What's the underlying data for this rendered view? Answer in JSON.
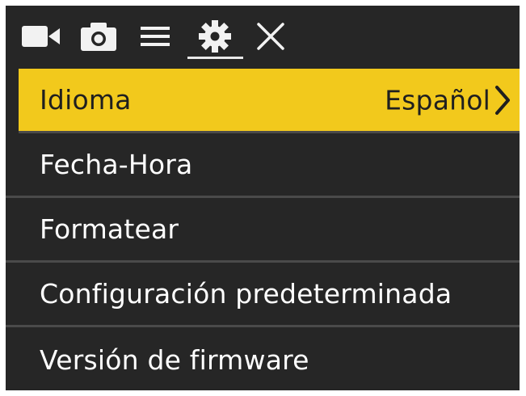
{
  "toolbar": {
    "icons": [
      "video-camera-icon",
      "photo-camera-icon",
      "menu-lines-icon",
      "gear-icon",
      "close-icon"
    ],
    "active_tab": "gear-icon"
  },
  "menu": {
    "items": [
      {
        "label": "Idioma",
        "value": "Español",
        "selected": true
      },
      {
        "label": "Fecha-Hora"
      },
      {
        "label": "Formatear"
      },
      {
        "label": "Configuración predeterminada"
      },
      {
        "label": "Versión de firmware"
      }
    ]
  },
  "colors": {
    "background": "#262626",
    "highlight": "#f2c91c",
    "text": "#ffffff",
    "selected_text": "#1f1f1f",
    "divider": "#4a4a4a"
  }
}
